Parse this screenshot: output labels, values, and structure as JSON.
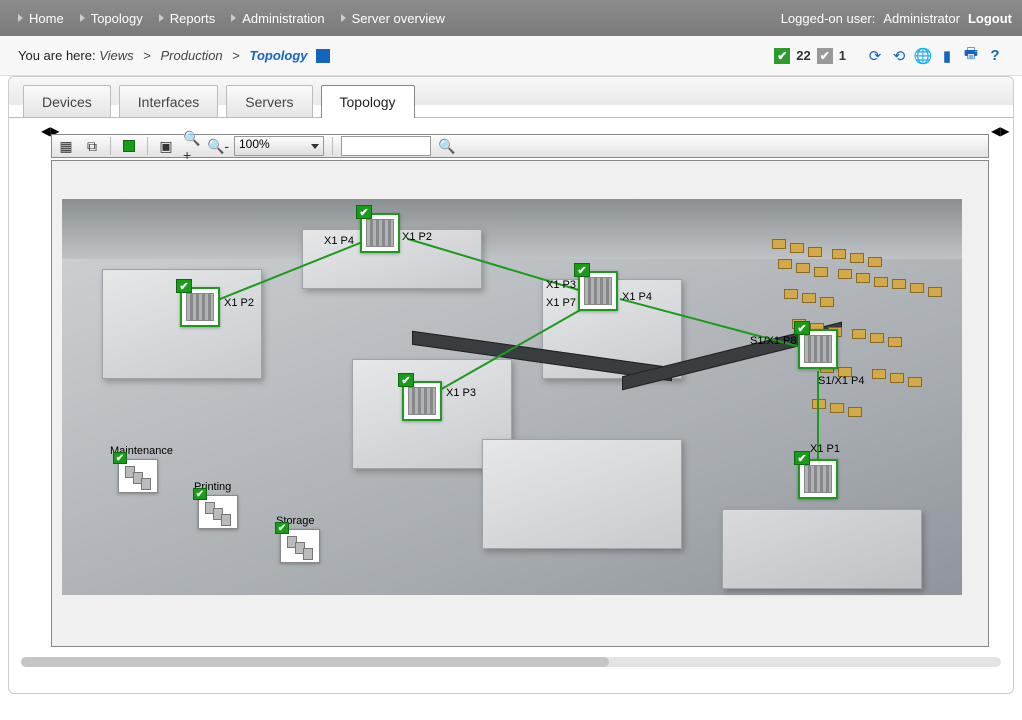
{
  "nav": {
    "items": [
      "Home",
      "Topology",
      "Reports",
      "Administration",
      "Server overview"
    ],
    "user_label": "Logged-on user:",
    "user_name": "Administrator",
    "logout": "Logout"
  },
  "breadcrumb": {
    "label": "You are here:",
    "views": "Views",
    "production": "Production",
    "current": "Topology"
  },
  "status": {
    "ok_count": "22",
    "grey_count": "1"
  },
  "tabs": {
    "devices": "Devices",
    "interfaces": "Interfaces",
    "servers": "Servers",
    "topology": "Topology"
  },
  "toolbar": {
    "zoom": "100%",
    "search": ""
  },
  "areas": {
    "maintenance": "Maintenance",
    "printing": "Printing",
    "storage": "Storage"
  },
  "ports": {
    "p1": "X1 P2",
    "p2": "X1 P4",
    "p3": "X1 P2",
    "p4": "X1 P3",
    "p5": "X1 P7",
    "p6": "X1 P4",
    "p7": "S1/X1 P8",
    "p8": "S1/X1 P4",
    "p9": "X1 P1",
    "p10": "X1 P3"
  }
}
